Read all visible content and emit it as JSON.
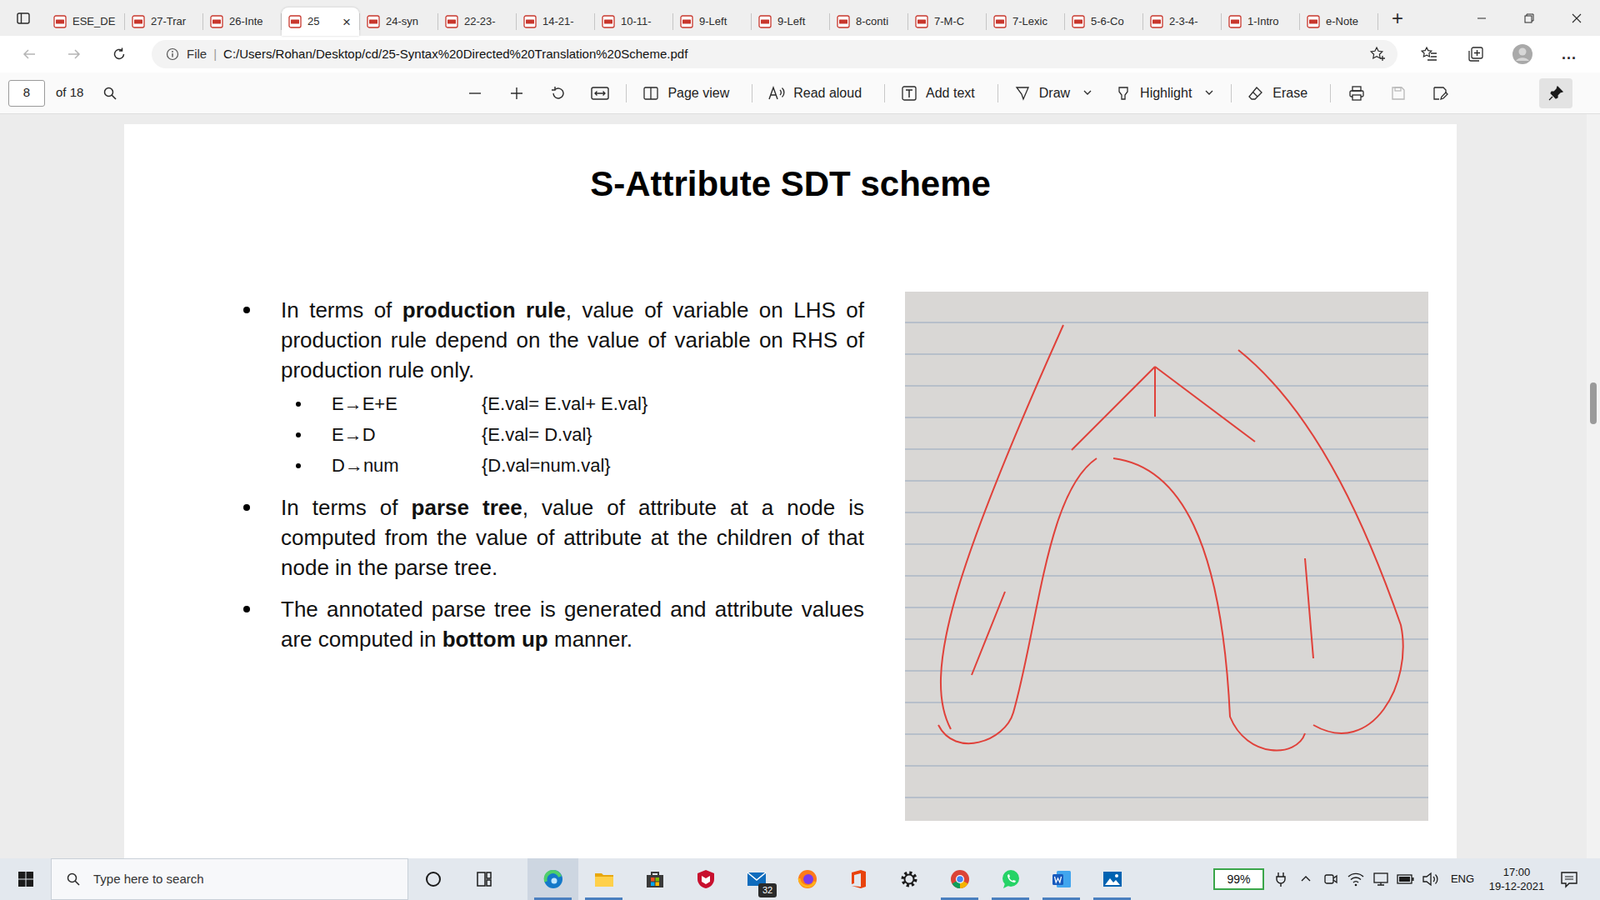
{
  "tabs": [
    {
      "label": "ESE_DE",
      "selected": false
    },
    {
      "label": "27-Trar",
      "selected": false
    },
    {
      "label": "26-Inte",
      "selected": false
    },
    {
      "label": "25",
      "selected": true
    },
    {
      "label": "24-syn",
      "selected": false
    },
    {
      "label": "22-23-",
      "selected": false
    },
    {
      "label": "14-21-",
      "selected": false
    },
    {
      "label": "10-11-",
      "selected": false
    },
    {
      "label": "9-Left",
      "selected": false
    },
    {
      "label": "9-Left",
      "selected": false
    },
    {
      "label": "8-conti",
      "selected": false
    },
    {
      "label": "7-M-C",
      "selected": false
    },
    {
      "label": "7-Lexic",
      "selected": false
    },
    {
      "label": "5-6-Co",
      "selected": false
    },
    {
      "label": "2-3-4-",
      "selected": false
    },
    {
      "label": "1-Intro",
      "selected": false
    },
    {
      "label": "e-Note",
      "selected": false
    }
  ],
  "tab_close": "×",
  "new_tab": "+",
  "address_bar": {
    "scheme": "File",
    "separator": "|",
    "url": "C:/Users/Rohan/Desktop/cd/25-Syntax%20Directed%20Translation%20Scheme.pdf"
  },
  "menu_button": "...",
  "pdf_toolbar": {
    "page": "8",
    "page_count": "of 18",
    "tools": [
      {
        "label": "Page view",
        "kind": "pageview",
        "dropdown": false
      },
      {
        "label": "Read aloud",
        "kind": "readaloud",
        "dropdown": false
      },
      {
        "label": "Add text",
        "kind": "addtext",
        "dropdown": false
      },
      {
        "label": "Draw",
        "kind": "draw",
        "dropdown": true
      },
      {
        "label": "Highlight",
        "kind": "highlight",
        "dropdown": true
      },
      {
        "label": "Erase",
        "kind": "erase",
        "dropdown": false
      }
    ]
  },
  "document": {
    "title": "S-Attribute SDT scheme",
    "bullets": [
      {
        "segments": [
          {
            "text": "In terms of ",
            "bold": false
          },
          {
            "text": "production rule",
            "bold": true
          },
          {
            "text": ", value of variable on LHS of production rule depend on the value of variable on RHS of production rule only.",
            "bold": false
          }
        ],
        "rules": [
          {
            "production": "E→E+E",
            "action": "{E.val= E.val+ E.val}"
          },
          {
            "production": "E→D",
            "action": "{E.val= D.val}"
          },
          {
            "production": "D→num",
            "action": "{D.val=num.val}"
          }
        ]
      },
      {
        "segments": [
          {
            "text": "In terms of ",
            "bold": false
          },
          {
            "text": "parse tree",
            "bold": true
          },
          {
            "text": ", value of attribute at a node is computed from the value of attribute at the children of that node in the parse tree.",
            "bold": false
          }
        ],
        "rules": []
      },
      {
        "segments": [
          {
            "text": "The annotated parse tree is generated and attribute values are computed in ",
            "bold": false
          },
          {
            "text": "bottom up",
            "bold": true
          },
          {
            "text": " manner.",
            "bold": false
          }
        ],
        "rules": []
      }
    ]
  },
  "taskbar": {
    "search_placeholder": "Type here to search",
    "apps": [
      {
        "kind": "edge",
        "running": true,
        "selected": true
      },
      {
        "kind": "explorer",
        "running": true,
        "selected": false
      },
      {
        "kind": "store",
        "running": false,
        "selected": false
      },
      {
        "kind": "mcafee",
        "running": false,
        "selected": false
      },
      {
        "kind": "mail",
        "running": false,
        "selected": false,
        "badge": "32"
      },
      {
        "kind": "firefox",
        "running": false,
        "selected": false
      },
      {
        "kind": "office",
        "running": false,
        "selected": false
      },
      {
        "kind": "settings",
        "running": false,
        "selected": false
      },
      {
        "kind": "chrome",
        "running": true,
        "selected": false
      },
      {
        "kind": "whatsapp",
        "running": true,
        "selected": false
      },
      {
        "kind": "word",
        "running": true,
        "selected": false
      },
      {
        "kind": "photos",
        "running": true,
        "selected": false
      }
    ],
    "battery": "99%",
    "language": "ENG",
    "time": "17:00",
    "date": "19-12-2021"
  }
}
